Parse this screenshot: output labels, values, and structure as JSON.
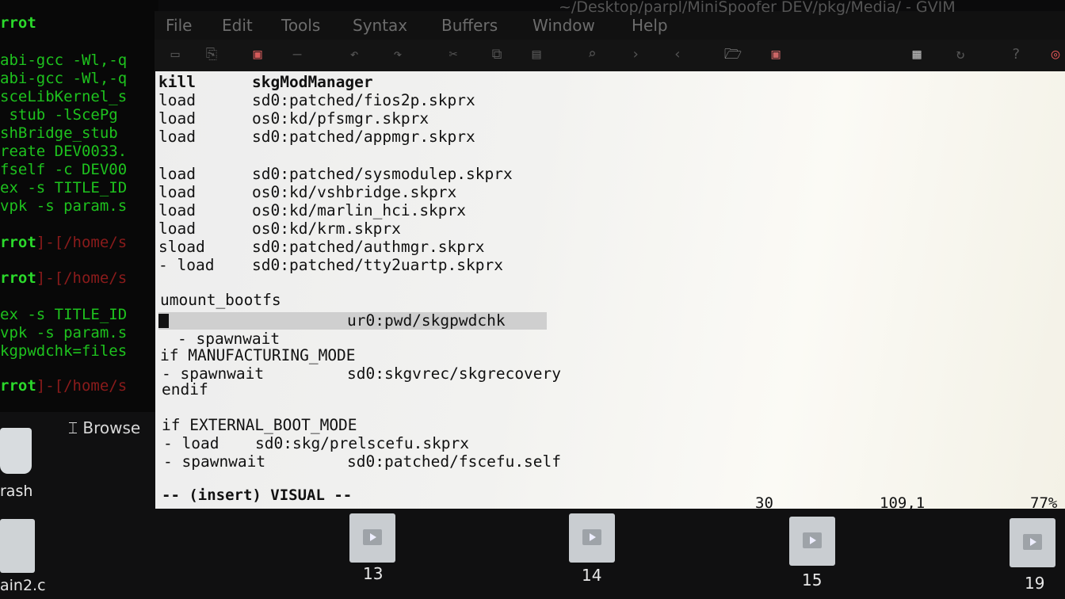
{
  "window": {
    "title_fragment": "~/Desktop/parpl/MiniSpoofer DEV/pkg/Media/ - GVIM"
  },
  "menu": [
    "File",
    "Edit",
    "Tools",
    "Syntax",
    "Buffers",
    "Window",
    "Help"
  ],
  "toolbar_icons": [
    "open-icon",
    "save-session-icon",
    "save-icon",
    "print-icon",
    "undo-icon",
    "redo-icon",
    "cut-icon",
    "copy-icon",
    "paste-icon",
    "find-icon",
    "find-next-icon",
    "find-prev-icon",
    "load-session-icon",
    "save-session-icon-2",
    "make-icon",
    "run-ctags-icon",
    "help-icon",
    "find-help-icon"
  ],
  "terminal": {
    "lines": [
      "rrot",
      "abi-gcc -Wl,-q",
      "abi-gcc -Wl,-q",
      "sceLibKernel_s",
      " stub -lScePg",
      "shBridge_stub ",
      "reate DEV0033.",
      "fself -c DEV00",
      "ex -s TITLE_ID",
      "vpk -s param.s",
      "",
      "rrot",
      "",
      "rrot",
      "",
      "ex -s TITLE_ID",
      "vpk -s param.s",
      "kgpwdchk=files",
      "",
      "rrot"
    ],
    "path_fragment": "]-[/home/s"
  },
  "editor": {
    "lines": [
      {
        "kw": "kill",
        "arg": "skgModManager",
        "bold_arg": true
      },
      {
        "kw": "load",
        "arg": "sd0:patched/fios2p.skprx"
      },
      {
        "kw": "load",
        "arg": "os0:kd/pfsmgr.skprx"
      },
      {
        "kw": "load",
        "arg": "sd0:patched/appmgr.skprx"
      },
      {
        "kw": "",
        "arg": ""
      },
      {
        "kw": "load",
        "arg": "sd0:patched/sysmodulep.skprx"
      },
      {
        "kw": "load",
        "arg": "os0:kd/vshbridge.skprx"
      },
      {
        "kw": "load",
        "arg": "os0:kd/marlin_hci.skprx"
      },
      {
        "kw": "load",
        "arg": "os0:kd/krm.skprx"
      },
      {
        "kw": "sload",
        "arg": "sd0:patched/authmgr.skprx"
      },
      {
        "kw": "- load",
        "arg": "sd0:patched/tty2uartp.skprx"
      }
    ],
    "umount": "umount_bootfs",
    "selected_line": {
      "kw": "- spawnwait",
      "arg": "ur0:pwd/skgpwdchk"
    },
    "block1": [
      "if MANUFACTURING_MODE",
      "- spawnwait",
      "sd0:skgvrec/skgrecovery",
      "endif"
    ],
    "block2": [
      "if EXTERNAL_BOOT_MODE",
      "- load",
      "sd0:skg/prelscefu.skprx",
      "- spawnwait",
      "sd0:patched/fscefu.self"
    ]
  },
  "status": {
    "mode": "-- (insert) VISUAL --",
    "count": "30",
    "position": "109,1",
    "percent": "77%"
  },
  "browser": {
    "label": "Browse",
    "desktop_labels": [
      "rash",
      "ain2.c"
    ],
    "files": [
      "13",
      "14",
      "15",
      "19"
    ]
  }
}
